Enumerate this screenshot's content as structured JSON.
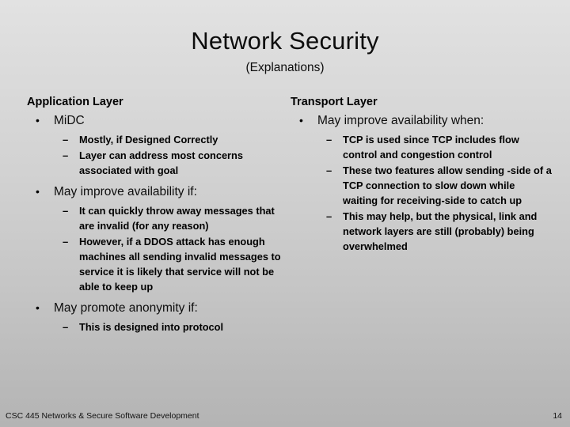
{
  "slide": {
    "title": "Network Security",
    "subtitle": "(Explanations)",
    "bullet_glyph": "•",
    "dash_glyph": "–"
  },
  "columns": [
    {
      "heading": "Application Layer",
      "items": [
        {
          "text": "MiDC",
          "sub": [
            "Mostly, if Designed Correctly",
            "Layer can address most concerns associated with goal"
          ]
        },
        {
          "text": "May improve availability if:",
          "sub": [
            "It can quickly throw away messages that are invalid (for any reason)",
            "However, if a DDOS attack has enough machines all sending invalid messages to service it is likely that service will not be able to keep up"
          ]
        },
        {
          "text": "May promote anonymity if:",
          "sub": [
            "This is designed into protocol"
          ]
        }
      ]
    },
    {
      "heading": "Transport Layer",
      "items": [
        {
          "text": "May improve availability when:",
          "sub": [
            "TCP is used since TCP includes flow control and congestion control",
            "These two features allow sending -side of a TCP connection to slow down while waiting for receiving-side to catch up",
            "This may help, but the physical, link and network layers are still (probably) being overwhelmed"
          ]
        }
      ]
    }
  ],
  "footer": {
    "course": "CSC 445 Networks & Secure Software Development",
    "page_number": "14"
  }
}
